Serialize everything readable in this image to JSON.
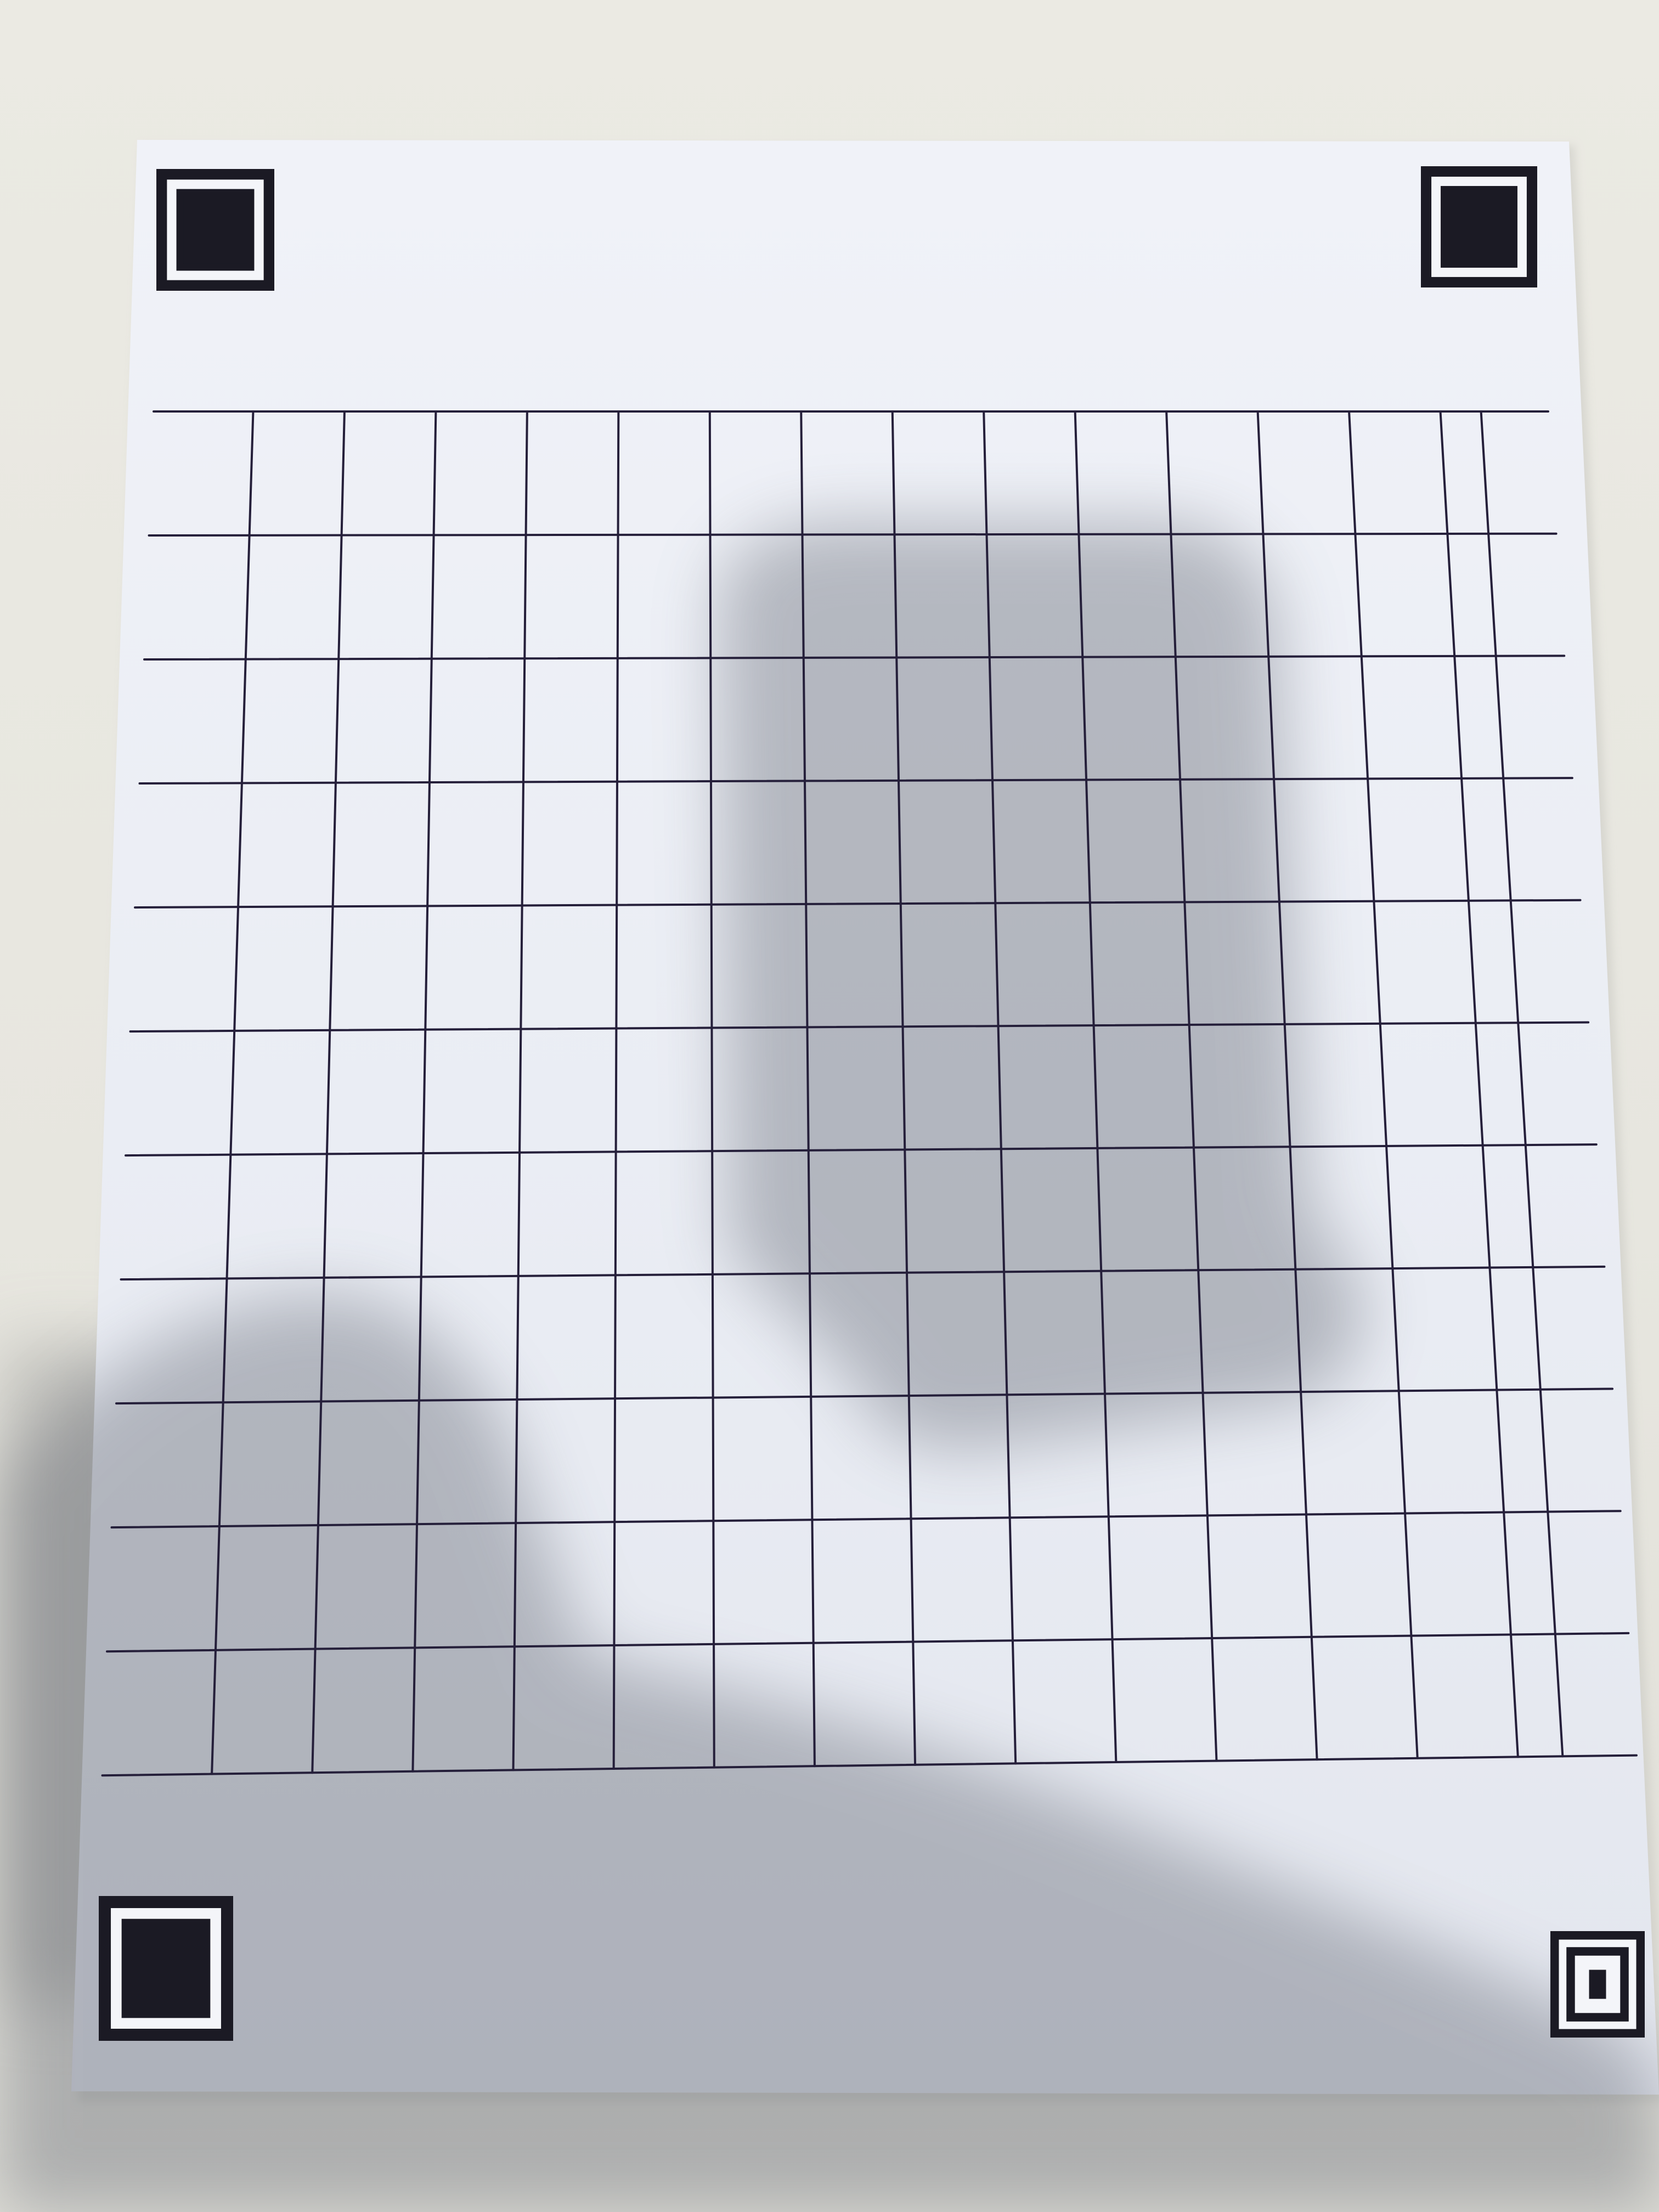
{
  "scene": {
    "subject": "printed-grid-sheet",
    "grid_rows": 11,
    "grid_cols": 15,
    "markers": [
      {
        "corner": "top-left",
        "style": "nested-square"
      },
      {
        "corner": "top-right",
        "style": "nested-square"
      },
      {
        "corner": "bottom-left",
        "style": "nested-square"
      },
      {
        "corner": "bottom-right",
        "style": "nested-square-small-center"
      }
    ]
  },
  "colors": {
    "surface": "#e9e8e1",
    "paper": "#eceff6",
    "line": "#251f3a",
    "marker": "#1b1a24",
    "shadow": "#5a5e6a"
  }
}
